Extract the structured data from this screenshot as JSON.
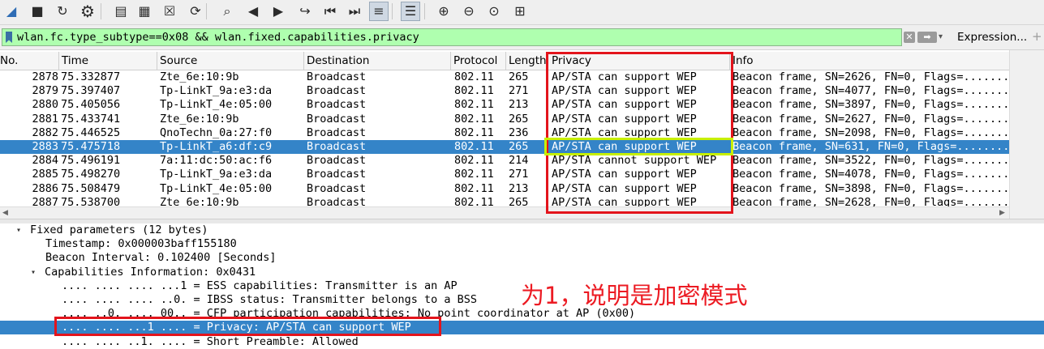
{
  "toolbar": {
    "buttons": [
      {
        "name": "shark-fin-start-icon",
        "glyph": "◢"
      },
      {
        "name": "stop-capture-icon",
        "glyph": "■"
      },
      {
        "name": "restart-capture-icon",
        "glyph": "↻"
      },
      {
        "name": "capture-options-gear-icon",
        "glyph": "⚙"
      },
      {
        "name": "open-file-icon",
        "glyph": "▤"
      },
      {
        "name": "save-file-icon",
        "glyph": "▦"
      },
      {
        "name": "close-file-icon",
        "glyph": "☒"
      },
      {
        "name": "reload-file-icon",
        "glyph": "⟳"
      },
      {
        "name": "find-packet-icon",
        "glyph": "⌕"
      },
      {
        "name": "go-back-icon",
        "glyph": "◀"
      },
      {
        "name": "go-forward-icon",
        "glyph": "▶"
      },
      {
        "name": "go-to-packet-icon",
        "glyph": "↪"
      },
      {
        "name": "first-packet-icon",
        "glyph": "⏮"
      },
      {
        "name": "last-packet-icon",
        "glyph": "⏭"
      },
      {
        "name": "auto-scroll-icon",
        "glyph": "≡"
      },
      {
        "name": "colorize-icon",
        "glyph": "☰"
      },
      {
        "name": "zoom-in-icon",
        "glyph": "⊕"
      },
      {
        "name": "zoom-out-icon",
        "glyph": "⊖"
      },
      {
        "name": "normal-size-icon",
        "glyph": "⊙"
      },
      {
        "name": "resize-columns-icon",
        "glyph": "⊞"
      }
    ]
  },
  "filter": {
    "text": "wlan.fc.type_subtype==0x08 && wlan.fixed.capabilities.privacy",
    "expression_label": "Expression...",
    "clear_glyph": "✕",
    "apply_glyph": "➡",
    "dropdown_glyph": "▾",
    "add_glyph": "+"
  },
  "columns": [
    "No.",
    "Time",
    "Source",
    "Destination",
    "Protocol",
    "Length",
    "Privacy",
    "Info"
  ],
  "packets": [
    {
      "no": "2878",
      "time": "75.332877",
      "src": "Zte_6e:10:9b",
      "dst": "Broadcast",
      "proto": "802.11",
      "len": "265",
      "privacy": "AP/STA can support WEP",
      "info": "Beacon frame, SN=2626, FN=0, Flags=........"
    },
    {
      "no": "2879",
      "time": "75.397407",
      "src": "Tp-LinkT_9a:e3:da",
      "dst": "Broadcast",
      "proto": "802.11",
      "len": "271",
      "privacy": "AP/STA can support WEP",
      "info": "Beacon frame, SN=4077, FN=0, Flags=........"
    },
    {
      "no": "2880",
      "time": "75.405056",
      "src": "Tp-LinkT_4e:05:00",
      "dst": "Broadcast",
      "proto": "802.11",
      "len": "213",
      "privacy": "AP/STA can support WEP",
      "info": "Beacon frame, SN=3897, FN=0, Flags=........"
    },
    {
      "no": "2881",
      "time": "75.433741",
      "src": "Zte_6e:10:9b",
      "dst": "Broadcast",
      "proto": "802.11",
      "len": "265",
      "privacy": "AP/STA can support WEP",
      "info": "Beacon frame, SN=2627, FN=0, Flags=........"
    },
    {
      "no": "2882",
      "time": "75.446525",
      "src": "QnoTechn_0a:27:f0",
      "dst": "Broadcast",
      "proto": "802.11",
      "len": "236",
      "privacy": "AP/STA can support WEP",
      "info": "Beacon frame, SN=2098, FN=0, Flags=........"
    },
    {
      "no": "2883",
      "time": "75.475718",
      "src": "Tp-LinkT_a6:df:c9",
      "dst": "Broadcast",
      "proto": "802.11",
      "len": "265",
      "privacy": "AP/STA can support WEP",
      "info": "Beacon frame, SN=631, FN=0, Flags=........"
    },
    {
      "no": "2884",
      "time": "75.496191",
      "src": "7a:11:dc:50:ac:f6",
      "dst": "Broadcast",
      "proto": "802.11",
      "len": "214",
      "privacy": "AP/STA cannot support WEP",
      "info": "Beacon frame, SN=3522, FN=0, Flags=........"
    },
    {
      "no": "2885",
      "time": "75.498270",
      "src": "Tp-LinkT_9a:e3:da",
      "dst": "Broadcast",
      "proto": "802.11",
      "len": "271",
      "privacy": "AP/STA can support WEP",
      "info": "Beacon frame, SN=4078, FN=0, Flags=........"
    },
    {
      "no": "2886",
      "time": "75.508479",
      "src": "Tp-LinkT_4e:05:00",
      "dst": "Broadcast",
      "proto": "802.11",
      "len": "213",
      "privacy": "AP/STA can support WEP",
      "info": "Beacon frame, SN=3898, FN=0, Flags=........"
    },
    {
      "no": "2887",
      "time": "75.538700",
      "src": "Zte_6e:10:9b",
      "dst": "Broadcast",
      "proto": "802.11",
      "len": "265",
      "privacy": "AP/STA can support WEP",
      "info": "Beacon frame, SN=2628, FN=0, Flags=........"
    }
  ],
  "selected_packet_index": 5,
  "details": [
    {
      "indent": 0,
      "toggle": "▾",
      "text": "Fixed parameters (12 bytes)"
    },
    {
      "indent": 1,
      "toggle": "",
      "text": "Timestamp: 0x000003baff155180"
    },
    {
      "indent": 1,
      "toggle": "",
      "text": "Beacon Interval: 0.102400 [Seconds]"
    },
    {
      "indent": 1,
      "toggle": "▾",
      "text": "Capabilities Information: 0x0431"
    },
    {
      "indent": 2,
      "toggle": "",
      "text": ".... .... .... ...1 = ESS capabilities: Transmitter is an AP"
    },
    {
      "indent": 2,
      "toggle": "",
      "text": ".... .... .... ..0. = IBSS status: Transmitter belongs to a BSS"
    },
    {
      "indent": 2,
      "toggle": "",
      "text": ".... ..0. .... 00.. = CFP participation capabilities: No point coordinator at AP (0x00)"
    },
    {
      "indent": 2,
      "toggle": "",
      "text": ".... .... ...1 .... = Privacy: AP/STA can support WEP"
    },
    {
      "indent": 2,
      "toggle": "",
      "text": ".... .... ..1. .... = Short Preamble: Allowed"
    }
  ],
  "selected_detail_index": 7,
  "annotation": {
    "text": "为1，说明是加密模式",
    "color": "#ec1b23"
  },
  "colors": {
    "selection": "#3484c8",
    "filter_valid": "#afffaf",
    "highlight_red": "#e3141c",
    "highlight_yellow": "#c8f000"
  }
}
